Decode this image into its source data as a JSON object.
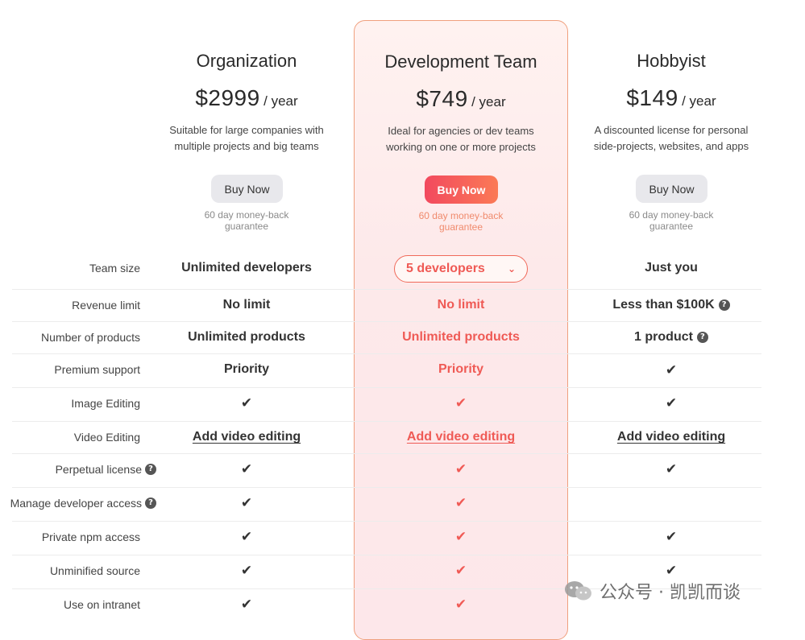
{
  "plans": [
    {
      "name": "Organization",
      "price": "$2999",
      "per": "/ year",
      "desc1": "Suitable for large companies with",
      "desc2": "multiple projects and big teams",
      "buy": "Buy Now",
      "g1": "60 day money-back",
      "g2": "guarantee"
    },
    {
      "name": "Development Team",
      "price": "$749",
      "per": "/ year",
      "desc1": "Ideal for agencies or dev teams",
      "desc2": "working on one or more projects",
      "buy": "Buy Now",
      "g1": "60 day money-back",
      "g2": "guarantee"
    },
    {
      "name": "Hobbyist",
      "price": "$149",
      "per": "/ year",
      "desc1": "A discounted license for personal",
      "desc2": "side-projects, websites, and apps",
      "buy": "Buy Now",
      "g1": "60 day money-back",
      "g2": "guarantee"
    }
  ],
  "features": {
    "team_size": {
      "label": "Team size",
      "org": "Unlimited developers",
      "dev": "5 developers",
      "hob": "Just you"
    },
    "revenue": {
      "label": "Revenue limit",
      "org": "No limit",
      "dev": "No limit",
      "hob": "Less than $100K"
    },
    "products": {
      "label": "Number of products",
      "org": "Unlimited products",
      "dev": "Unlimited products",
      "hob": "1 product"
    },
    "support": {
      "label": "Premium support",
      "org": "Priority",
      "dev": "Priority"
    },
    "image": {
      "label": "Image Editing"
    },
    "video": {
      "label": "Video Editing",
      "org": "Add video editing",
      "dev": "Add video editing",
      "hob": "Add video editing"
    },
    "perpetual": {
      "label": "Perpetual license"
    },
    "manage": {
      "label": "Manage developer access"
    },
    "npm": {
      "label": "Private npm access"
    },
    "unminified": {
      "label": "Unminified source"
    },
    "intranet": {
      "label": "Use on intranet"
    }
  },
  "icons": {
    "check": "✔",
    "help": "?",
    "chevron": "⌄"
  },
  "watermark": {
    "text": "公众号 · 凯凯而谈"
  },
  "colors": {
    "accent": "#ef5a55",
    "accent_end": "#fb7a56",
    "highlight_border": "#f0a07e"
  }
}
